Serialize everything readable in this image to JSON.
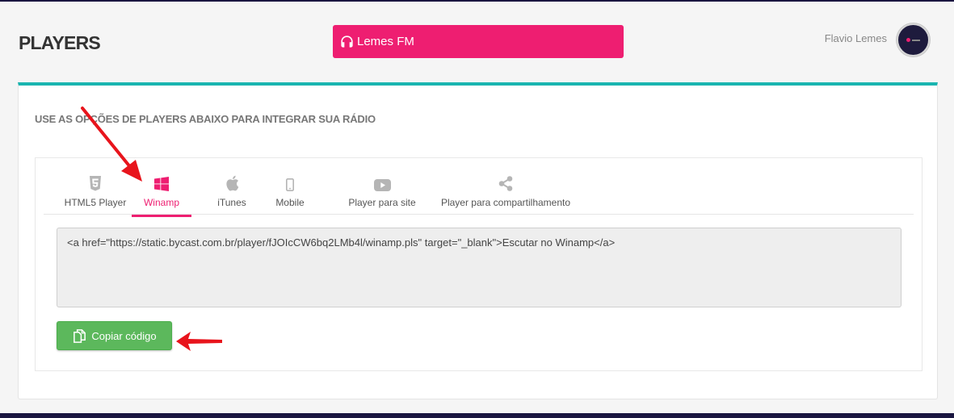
{
  "header": {
    "title": "PLAYERS",
    "station_name": "Lemes FM",
    "user_name": "Flavio Lemes"
  },
  "card": {
    "subtitle": "USE AS OPÇÕES DE PLAYERS ABAIXO PARA INTEGRAR SUA RÁDIO"
  },
  "tabs": [
    {
      "label": "HTML5 Player",
      "icon": "html5-icon",
      "active": false
    },
    {
      "label": "Winamp",
      "icon": "windows-icon",
      "active": true
    },
    {
      "label": "iTunes",
      "icon": "apple-icon",
      "active": false
    },
    {
      "label": "Mobile",
      "icon": "mobile-icon",
      "active": false
    },
    {
      "label": "Player para site",
      "icon": "youtube-icon",
      "active": false
    },
    {
      "label": "Player para compartilhamento",
      "icon": "share-icon",
      "active": false
    }
  ],
  "code": {
    "value": "<a href=\"https://static.bycast.com.br/player/fJOIcCW6bq2LMb4l/winamp.pls\" target=\"_blank\">Escutar no Winamp</a>"
  },
  "copy_button": {
    "label": "Copiar código"
  },
  "colors": {
    "accent": "#ee1e71",
    "teal": "#19b5b0",
    "success": "#5cb85c",
    "annotation": "#e8141c"
  }
}
